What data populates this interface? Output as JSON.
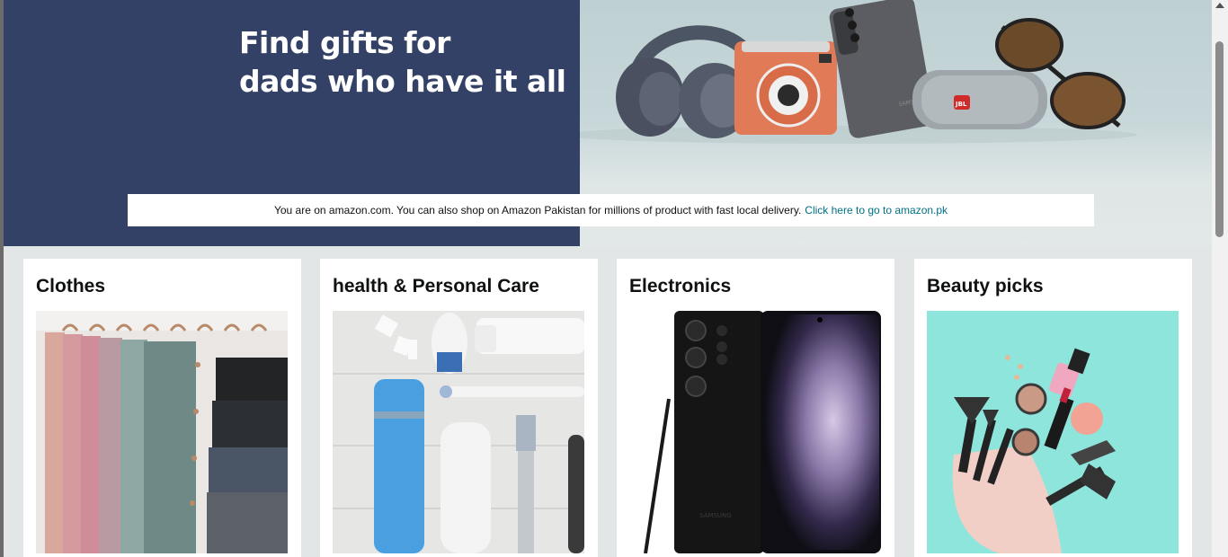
{
  "hero": {
    "title_line1": "Find gifts for",
    "title_line2": "dads who have it all",
    "bg_left": "#344166",
    "product_icons": [
      "headphones-icon",
      "instant-camera-icon",
      "smartphone-icon",
      "speaker-icon",
      "sunglasses-icon"
    ],
    "speaker_brand": "JBL",
    "phone_brand": "SAMSUNG"
  },
  "notice": {
    "text": "You are on amazon.com. You can also shop on Amazon Pakistan for millions of product with fast local delivery.",
    "link": "Click here to go to amazon.pk",
    "link_color": "#007185"
  },
  "cards": [
    {
      "title": "Clothes"
    },
    {
      "title": "health & Personal Care"
    },
    {
      "title": "Electronics",
      "phone_brand": "SAMSUNG"
    },
    {
      "title": "Beauty picks"
    }
  ]
}
